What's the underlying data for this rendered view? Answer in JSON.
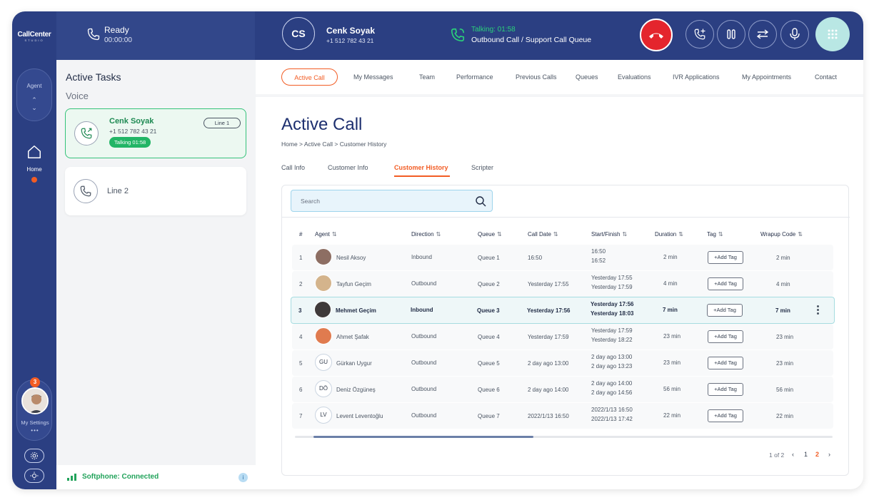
{
  "brand": {
    "name": "CallCenter",
    "tagline": "STUDIO"
  },
  "rail": {
    "agent_label": "Agent",
    "home_label": "Home",
    "notification_count": "3",
    "my_settings_label": "My Settings",
    "settings_dots": "•••"
  },
  "status": {
    "title": "Ready",
    "timer": "00:00:00"
  },
  "caller": {
    "initials": "CS",
    "name": "Cenk Soyak",
    "number": "+1 512 782 43 21",
    "talking": "Talking: 01:58",
    "queue": "Outbound Call / Support Call Queue"
  },
  "tasks": {
    "title": "Active Tasks",
    "voice_label": "Voice",
    "line1": {
      "name": "Cenk Soyak",
      "number": "+1 512 782 43 21",
      "talking": "Talking 01:58",
      "line_badge": "Line 1"
    },
    "line2": {
      "label": "Line 2"
    },
    "softphone": "Softphone: Connected",
    "info": "i"
  },
  "nav": {
    "items": [
      "Active Call",
      "My Messages",
      "Team",
      "Performance",
      "Previous Calls",
      "Queues",
      "Evaluations",
      "IVR Applications",
      "My Appointments",
      "Contact"
    ]
  },
  "page": {
    "title": "Active Call",
    "breadcrumb": "Home  >  Active Call  >  Customer History",
    "tabs": [
      "Call Info",
      "Customer Info",
      "Customer History",
      "Scripter"
    ],
    "search_placeholder": "Search"
  },
  "table": {
    "headers": [
      "#",
      "Agent",
      "Direction",
      "Queue",
      "Call Date",
      "Start/Finish",
      "Duration",
      "Tag",
      "Wrapup Code"
    ],
    "sort_icon": "⇅",
    "add_tag_label": "+Add Tag",
    "rows": [
      {
        "num": "1",
        "initials": "",
        "agent": "Nesil Aksoy",
        "direction": "Inbound",
        "queue": "Queue 1",
        "date": "16:50",
        "start": "16:50",
        "finish": "16:52",
        "duration": "2 min",
        "wrapup": "2 min"
      },
      {
        "num": "2",
        "initials": "",
        "agent": "Tayfun Geçim",
        "direction": "Outbound",
        "queue": "Queue 2",
        "date": "Yesterday 17:55",
        "start": "Yesterday 17:55",
        "finish": "Yesterday 17:59",
        "duration": "4 min",
        "wrapup": "4 min"
      },
      {
        "num": "3",
        "initials": "",
        "agent": "Mehmet Geçim",
        "direction": "Inbound",
        "queue": "Queue 3",
        "date": "Yesterday 17:56",
        "start": "Yesterday 17:56",
        "finish": "Yesterday 18:03",
        "duration": "7 min",
        "wrapup": "7 min"
      },
      {
        "num": "4",
        "initials": "",
        "agent": "Ahmet Şafak",
        "direction": "Outbound",
        "queue": "Queue 4",
        "date": "Yesterday 17:59",
        "start": "Yesterday 17:59",
        "finish": "Yesterday 18:22",
        "duration": "23 min",
        "wrapup": "23 min"
      },
      {
        "num": "5",
        "initials": "GU",
        "agent": "Gürkan Uygur",
        "direction": "Outbound",
        "queue": "Queue 5",
        "date": "2 day ago 13:00",
        "start": "2 day ago 13:00",
        "finish": "2 day ago 13:23",
        "duration": "23 min",
        "wrapup": "23 min"
      },
      {
        "num": "6",
        "initials": "DÖ",
        "agent": "Deniz Özgüneş",
        "direction": "Outbound",
        "queue": "Queue 6",
        "date": "2 day ago 14:00",
        "start": "2 day ago 14:00",
        "finish": "2 day ago 14:56",
        "duration": "56 min",
        "wrapup": "56 min"
      },
      {
        "num": "7",
        "initials": "LV",
        "agent": "Levent Leventoğlu",
        "direction": "Outbound",
        "queue": "Queue 7",
        "date": "2022/1/13 16:50",
        "start": "2022/1/13 16:50",
        "finish": "2022/1/13 17:42",
        "duration": "22 min",
        "wrapup": "22 min"
      }
    ]
  },
  "pagination": {
    "info": "1 of 2",
    "pages": [
      "1",
      "2"
    ],
    "current": "2",
    "prev": "‹",
    "next": "›"
  },
  "colors": {
    "primary": "#2b3f82",
    "accent": "#f25c24",
    "success": "#22b566",
    "danger": "#e4252d"
  }
}
